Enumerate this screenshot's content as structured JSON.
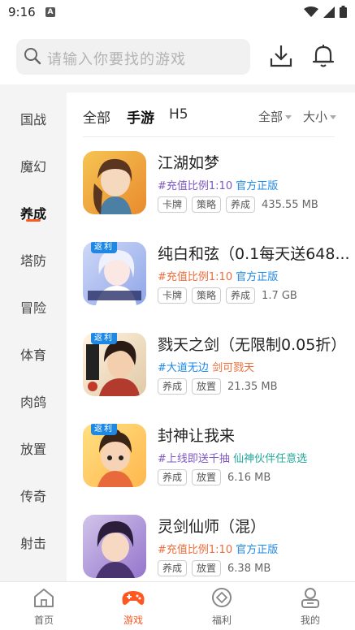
{
  "status_bar": {
    "time": "9:16",
    "notif_icon_letter": "A"
  },
  "search": {
    "placeholder": "请输入你要找的游戏"
  },
  "sidebar": {
    "items": [
      "国战",
      "魔幻",
      "养成",
      "塔防",
      "冒险",
      "体育",
      "肉鸽",
      "放置",
      "传奇",
      "射击"
    ],
    "active": "养成"
  },
  "tabs": {
    "all": "全部",
    "mobile": "手游",
    "h5": "H5"
  },
  "filters": {
    "category": "全部",
    "size": "大小"
  },
  "games": [
    {
      "name": "江湖如梦",
      "promo_prefix": "#",
      "promo_a": "充值比例1:10",
      "promo_b": "官方正版",
      "promo_color_a": "#7e57c2",
      "promo_color_b": "#1e88e5",
      "tags": [
        "卡牌",
        "策略",
        "养成"
      ],
      "size": "435.55 MB",
      "badge": ""
    },
    {
      "name": "纯白和弦（0.1每天送648...",
      "promo_prefix": "#",
      "promo_a": "充值比例1:10",
      "promo_b": "官方正版",
      "promo_color_a": "#ef6c3a",
      "promo_color_b": "#1e88e5",
      "tags": [
        "卡牌",
        "策略",
        "养成"
      ],
      "size": "1.7 GB",
      "badge": "返利"
    },
    {
      "name": "戮天之剑（无限制0.05折）",
      "promo_prefix": "#",
      "promo_a": "大道无边",
      "promo_b": "剑可戮天",
      "promo_color_a": "#1e88e5",
      "promo_color_b": "#ef6c3a",
      "tags": [
        "养成",
        "放置"
      ],
      "size": "21.35 MB",
      "badge": "返利"
    },
    {
      "name": "封神让我来",
      "promo_prefix": "#",
      "promo_a": "上线即送千抽",
      "promo_b": "仙神伙伴任意选",
      "promo_color_a": "#7e57c2",
      "promo_color_b": "#26a69a",
      "tags": [
        "养成",
        "放置"
      ],
      "size": "6.16 MB",
      "badge": "返利"
    },
    {
      "name": "灵剑仙师（混）",
      "promo_prefix": "#",
      "promo_a": "充值比例1:10",
      "promo_b": "官方正版",
      "promo_color_a": "#ef6c3a",
      "promo_color_b": "#1e88e5",
      "tags": [
        "养成",
        "放置"
      ],
      "size": "6.38 MB",
      "badge": ""
    }
  ],
  "bottom_nav": {
    "home": "首页",
    "games": "游戏",
    "welfare": "福利",
    "mine": "我的"
  },
  "colors": {
    "accent": "#ff5722"
  }
}
